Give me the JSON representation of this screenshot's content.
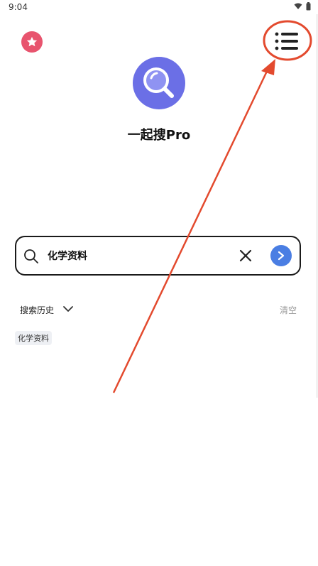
{
  "status_bar": {
    "time": "9:04"
  },
  "header": {
    "left_icon": "star-icon",
    "right_icon": "menu-list-icon"
  },
  "app": {
    "title": "一起搜Pro",
    "logo_icon": "magnifier-icon"
  },
  "search": {
    "query": "化学资料",
    "clear_icon": "close-icon",
    "submit_icon": "chevron-right-icon"
  },
  "history": {
    "label": "搜索历史",
    "clear_label": "清空",
    "items": [
      "化学资料"
    ]
  },
  "colors": {
    "accent": "#4a7ee3",
    "logo": "#6b6fe6",
    "star": "#e8546e",
    "annotation": "#e34a2e"
  }
}
